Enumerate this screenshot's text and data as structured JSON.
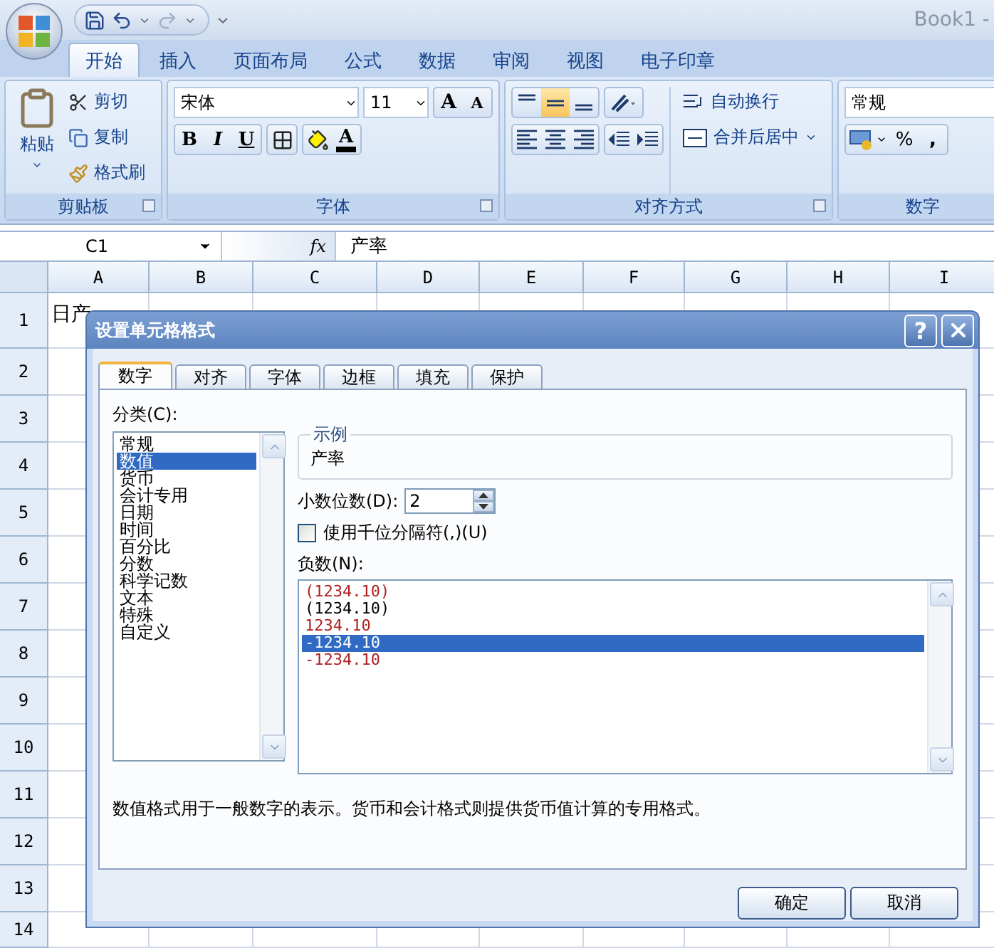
{
  "title_bar": {
    "title": "Book1 -"
  },
  "ribbon_tabs": [
    {
      "label": "开始",
      "selected": true
    },
    {
      "label": "插入",
      "selected": false
    },
    {
      "label": "页面布局",
      "selected": false
    },
    {
      "label": "公式",
      "selected": false
    },
    {
      "label": "数据",
      "selected": false
    },
    {
      "label": "审阅",
      "selected": false
    },
    {
      "label": "视图",
      "selected": false
    },
    {
      "label": "电子印章",
      "selected": false
    }
  ],
  "clipboard": {
    "paste": "粘贴",
    "cut": "剪切",
    "copy": "复制",
    "format_painter": "格式刷",
    "label": "剪贴板"
  },
  "font": {
    "name": "宋体",
    "size": "11",
    "grow": "A",
    "shrink": "A",
    "styles": [
      {
        "kind": "bold",
        "label": "B"
      },
      {
        "kind": "italic",
        "label": "I"
      },
      {
        "kind": "underline",
        "label": "U"
      }
    ],
    "font_color": "A",
    "label": "字体"
  },
  "alignment": {
    "vertical": [
      {
        "kind": "top",
        "selected": false
      },
      {
        "kind": "middle",
        "selected": true
      },
      {
        "kind": "bottom",
        "selected": false
      }
    ],
    "horizontal": [
      {
        "kind": "left"
      },
      {
        "kind": "center"
      },
      {
        "kind": "right"
      }
    ],
    "wrap_text": "自动换行",
    "merge": "合并后居中",
    "label": "对齐方式"
  },
  "number": {
    "format": "常规",
    "percent": "%",
    "comma": ",",
    "label": "数字"
  },
  "formula_bar": {
    "name_box": "C1",
    "fx": "fx",
    "formula": "产率"
  },
  "sheet": {
    "columns": [
      "A",
      "B",
      "C",
      "D",
      "E",
      "F",
      "G",
      "H",
      "I"
    ],
    "rows": [
      {
        "number": "1",
        "cells": [
          "日产"
        ]
      },
      {
        "number": "2"
      },
      {
        "number": "3"
      },
      {
        "number": "4"
      },
      {
        "number": "5"
      },
      {
        "number": "6"
      },
      {
        "number": "7"
      },
      {
        "number": "8"
      },
      {
        "number": "9"
      },
      {
        "number": "10"
      },
      {
        "number": "11"
      },
      {
        "number": "12"
      },
      {
        "number": "13"
      },
      {
        "number": "14"
      }
    ]
  },
  "dialog": {
    "title": "设置单元格格式",
    "help": "?",
    "tabs": [
      {
        "label": "数字",
        "selected": true
      },
      {
        "label": "对齐",
        "selected": false
      },
      {
        "label": "字体",
        "selected": false
      },
      {
        "label": "边框",
        "selected": false
      },
      {
        "label": "填充",
        "selected": false
      },
      {
        "label": "保护",
        "selected": false
      }
    ],
    "category_label": "分类(C):",
    "categories": [
      {
        "label": "常规",
        "selected": false
      },
      {
        "label": "数值",
        "selected": true
      },
      {
        "label": "货币",
        "selected": false
      },
      {
        "label": "会计专用",
        "selected": false
      },
      {
        "label": "日期",
        "selected": false
      },
      {
        "label": "时间",
        "selected": false
      },
      {
        "label": "百分比",
        "selected": false
      },
      {
        "label": "分数",
        "selected": false
      },
      {
        "label": "科学记数",
        "selected": false
      },
      {
        "label": "文本",
        "selected": false
      },
      {
        "label": "特殊",
        "selected": false
      },
      {
        "label": "自定义",
        "selected": false
      }
    ],
    "sample": {
      "label": "示例",
      "value": "产率"
    },
    "decimal_places": {
      "label": "小数位数(D):",
      "value": "2"
    },
    "thousands_separator": {
      "label": "使用千位分隔符(,)(U)",
      "checked": false
    },
    "negative_label": "负数(N):",
    "negative_formats": [
      {
        "label": "(1234.10)",
        "color": "#b02020",
        "selected": false
      },
      {
        "label": "(1234.10)",
        "color": "#000000",
        "selected": false
      },
      {
        "label": "1234.10",
        "color": "#b02020",
        "selected": false
      },
      {
        "label": "-1234.10",
        "selected": true
      },
      {
        "label": "-1234.10",
        "color": "#b02020",
        "selected": false
      }
    ],
    "description": "数值格式用于一般数字的表示。货币和会计格式则提供货币值计算的专用格式。",
    "buttons": [
      "确定",
      "取消"
    ]
  }
}
